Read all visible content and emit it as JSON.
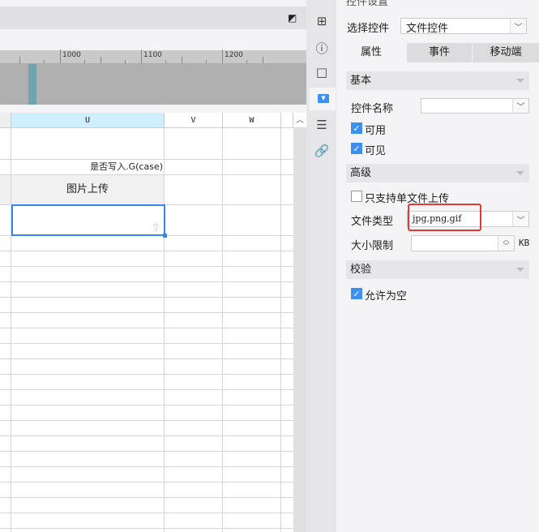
{
  "ruler": {
    "labels": [
      "1000",
      "1100",
      "1200"
    ]
  },
  "sheet": {
    "columns": [
      "U",
      "V",
      "W"
    ],
    "cell_formula": "是否写入.G(case)",
    "header_cell": "图片上传"
  },
  "panel": {
    "title": "控件设置",
    "select_control_label": "选择控件",
    "select_control_value": "文件控件",
    "tabs": [
      "属性",
      "事件",
      "移动端"
    ],
    "sections": {
      "basic": "基本",
      "advanced": "高级",
      "validation": "校验"
    },
    "control_name_label": "控件名称",
    "control_name_value": "",
    "enabled_label": "可用",
    "enabled": true,
    "visible_label": "可见",
    "visible": true,
    "single_upload_label": "只支持单文件上传",
    "single_upload": false,
    "file_type_label": "文件类型",
    "file_type_value": "jpg,png,gif",
    "size_limit_label": "大小限制",
    "size_limit_value": "",
    "size_unit": "KB",
    "allow_empty_label": "允许为空",
    "allow_empty": true
  },
  "colors": {
    "accent": "#3d8ff0",
    "highlight": "#e53935",
    "col_selected": "#cdeefa"
  }
}
